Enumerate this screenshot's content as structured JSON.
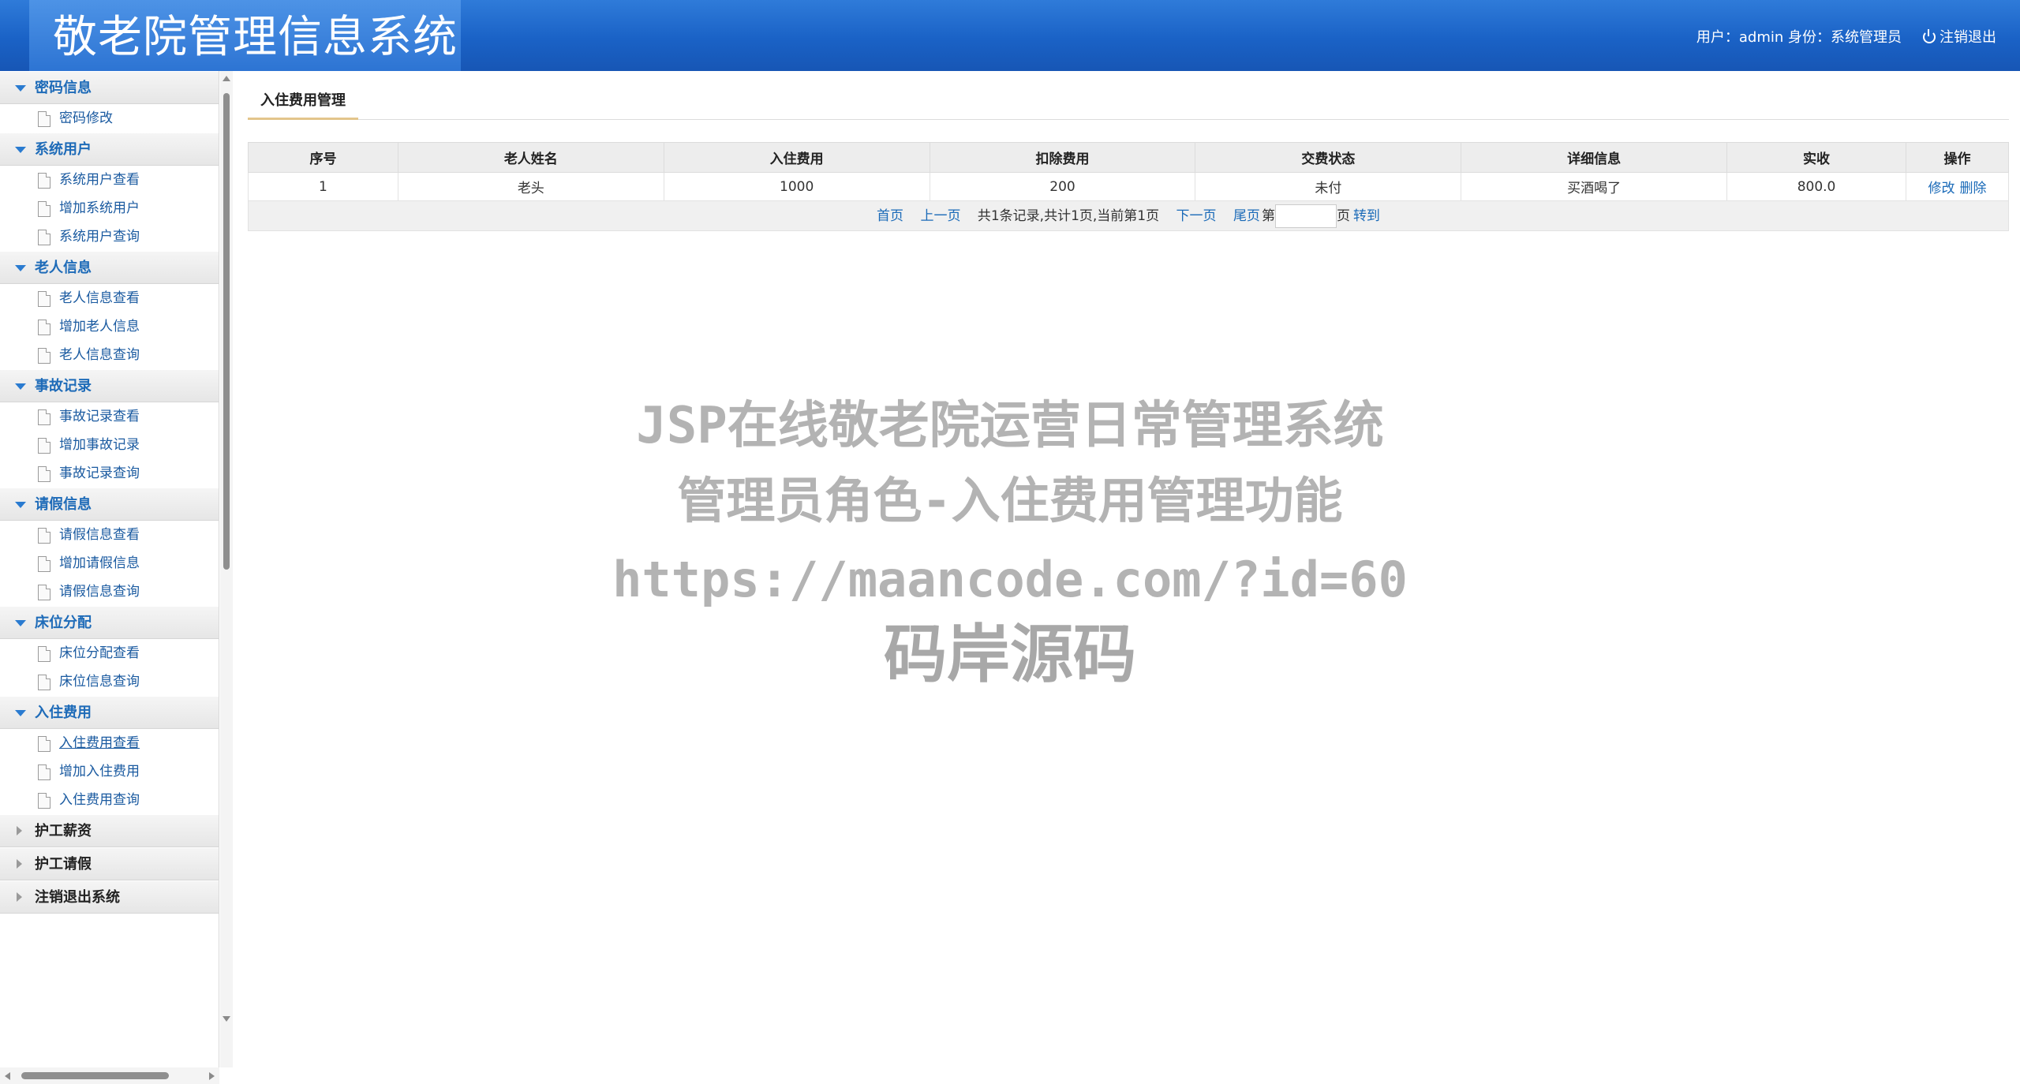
{
  "header": {
    "title": "敬老院管理信息系统",
    "user_info": "用户：admin 身份：系统管理员",
    "logout_label": "注销退出"
  },
  "sidebar": {
    "groups": [
      {
        "label": "密码信息",
        "expanded": true,
        "items": [
          "密码修改"
        ]
      },
      {
        "label": "系统用户",
        "expanded": true,
        "items": [
          "系统用户查看",
          "增加系统用户",
          "系统用户查询"
        ]
      },
      {
        "label": "老人信息",
        "expanded": true,
        "items": [
          "老人信息查看",
          "增加老人信息",
          "老人信息查询"
        ]
      },
      {
        "label": "事故记录",
        "expanded": true,
        "items": [
          "事故记录查看",
          "增加事故记录",
          "事故记录查询"
        ]
      },
      {
        "label": "请假信息",
        "expanded": true,
        "items": [
          "请假信息查看",
          "增加请假信息",
          "请假信息查询"
        ]
      },
      {
        "label": "床位分配",
        "expanded": true,
        "items": [
          "床位分配查看",
          "床位信息查询"
        ]
      },
      {
        "label": "入住费用",
        "expanded": true,
        "items": [
          "入住费用查看",
          "增加入住费用",
          "入住费用查询"
        ],
        "active_item": "入住费用查看"
      },
      {
        "label": "护工薪资",
        "expanded": false,
        "items": []
      },
      {
        "label": "护工请假",
        "expanded": false,
        "items": []
      },
      {
        "label": "注销退出系统",
        "expanded": false,
        "items": []
      }
    ]
  },
  "main": {
    "tab_label": "入住费用管理",
    "table": {
      "columns": [
        "序号",
        "老人姓名",
        "入住费用",
        "扣除费用",
        "交费状态",
        "详细信息",
        "实收",
        "操作"
      ],
      "rows": [
        {
          "no": "1",
          "name": "老头",
          "fee": "1000",
          "deduct": "200",
          "status": "未付",
          "detail": "买酒喝了",
          "actual": "800.0",
          "edit": "修改",
          "delete": "删除"
        }
      ]
    },
    "pager": {
      "first": "首页",
      "prev": "上一页",
      "summary": "共1条记录,共计1页,当前第1页",
      "next": "下一页",
      "last": "尾页",
      "page_prefix": "第",
      "page_input": "",
      "page_suffix": "页",
      "go": "转到"
    }
  },
  "watermark": {
    "line1": "JSP在线敬老院运营日常管理系统",
    "line2": "管理员角色-入住费用管理功能",
    "line3": "https://maancode.com/?id=60",
    "line4": "码岸源码"
  }
}
